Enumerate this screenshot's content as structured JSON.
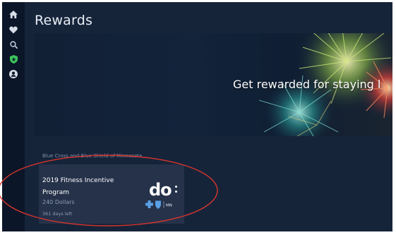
{
  "page": {
    "title": "Rewards"
  },
  "sidebar": {
    "items": [
      {
        "icon": "home-icon",
        "active": false
      },
      {
        "icon": "heart-icon",
        "active": false
      },
      {
        "icon": "search-icon",
        "active": false
      },
      {
        "icon": "shield-icon",
        "active": true
      },
      {
        "icon": "profile-icon",
        "active": false
      }
    ]
  },
  "hero": {
    "text": "Get rewarded for staying l"
  },
  "section": {
    "label": "Blue Cross and Blue Shield of Minnesota"
  },
  "reward_card": {
    "title": "2019 Fitness Incentive Program",
    "points": "240 Dollars",
    "days_left": "361 days left",
    "logo_text": "do",
    "badge_text": "MN"
  },
  "colors": {
    "background": "#16243a",
    "sidebar": "#0b1628",
    "card": "#25324a",
    "active_icon": "#3cc35a",
    "annotation": "#d9352b"
  }
}
